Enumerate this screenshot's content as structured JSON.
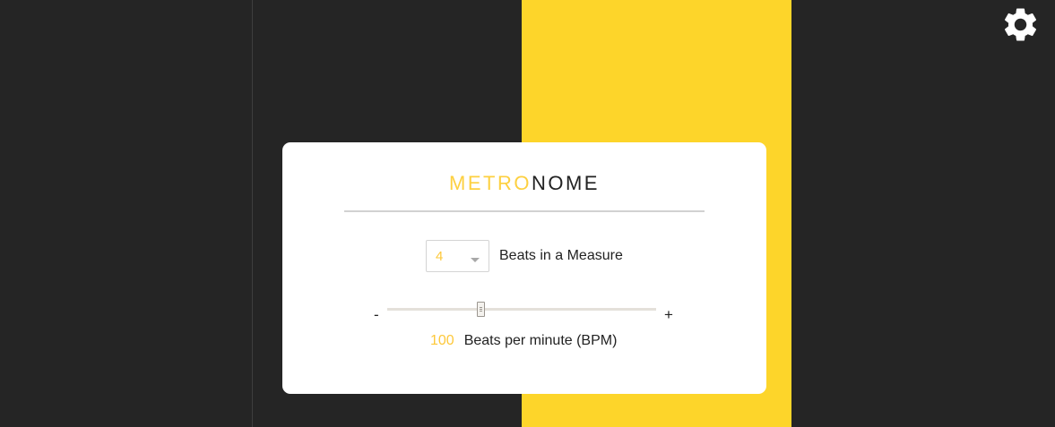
{
  "settings": {
    "icon": "gear-icon"
  },
  "colors": {
    "accent": "#fdd52a",
    "background": "#252525",
    "card": "#ffffff"
  },
  "beat_columns": {
    "active_index": 2
  },
  "title": {
    "accent_part": "METRO",
    "rest_part": "NOME"
  },
  "measure": {
    "beats_value": "4",
    "label": "Beats in a Measure"
  },
  "tempo": {
    "decrease_label": "-",
    "increase_label": "+",
    "bpm_value": "100",
    "bpm_label": "Beats per minute (BPM)",
    "slider_fraction": 0.345
  }
}
